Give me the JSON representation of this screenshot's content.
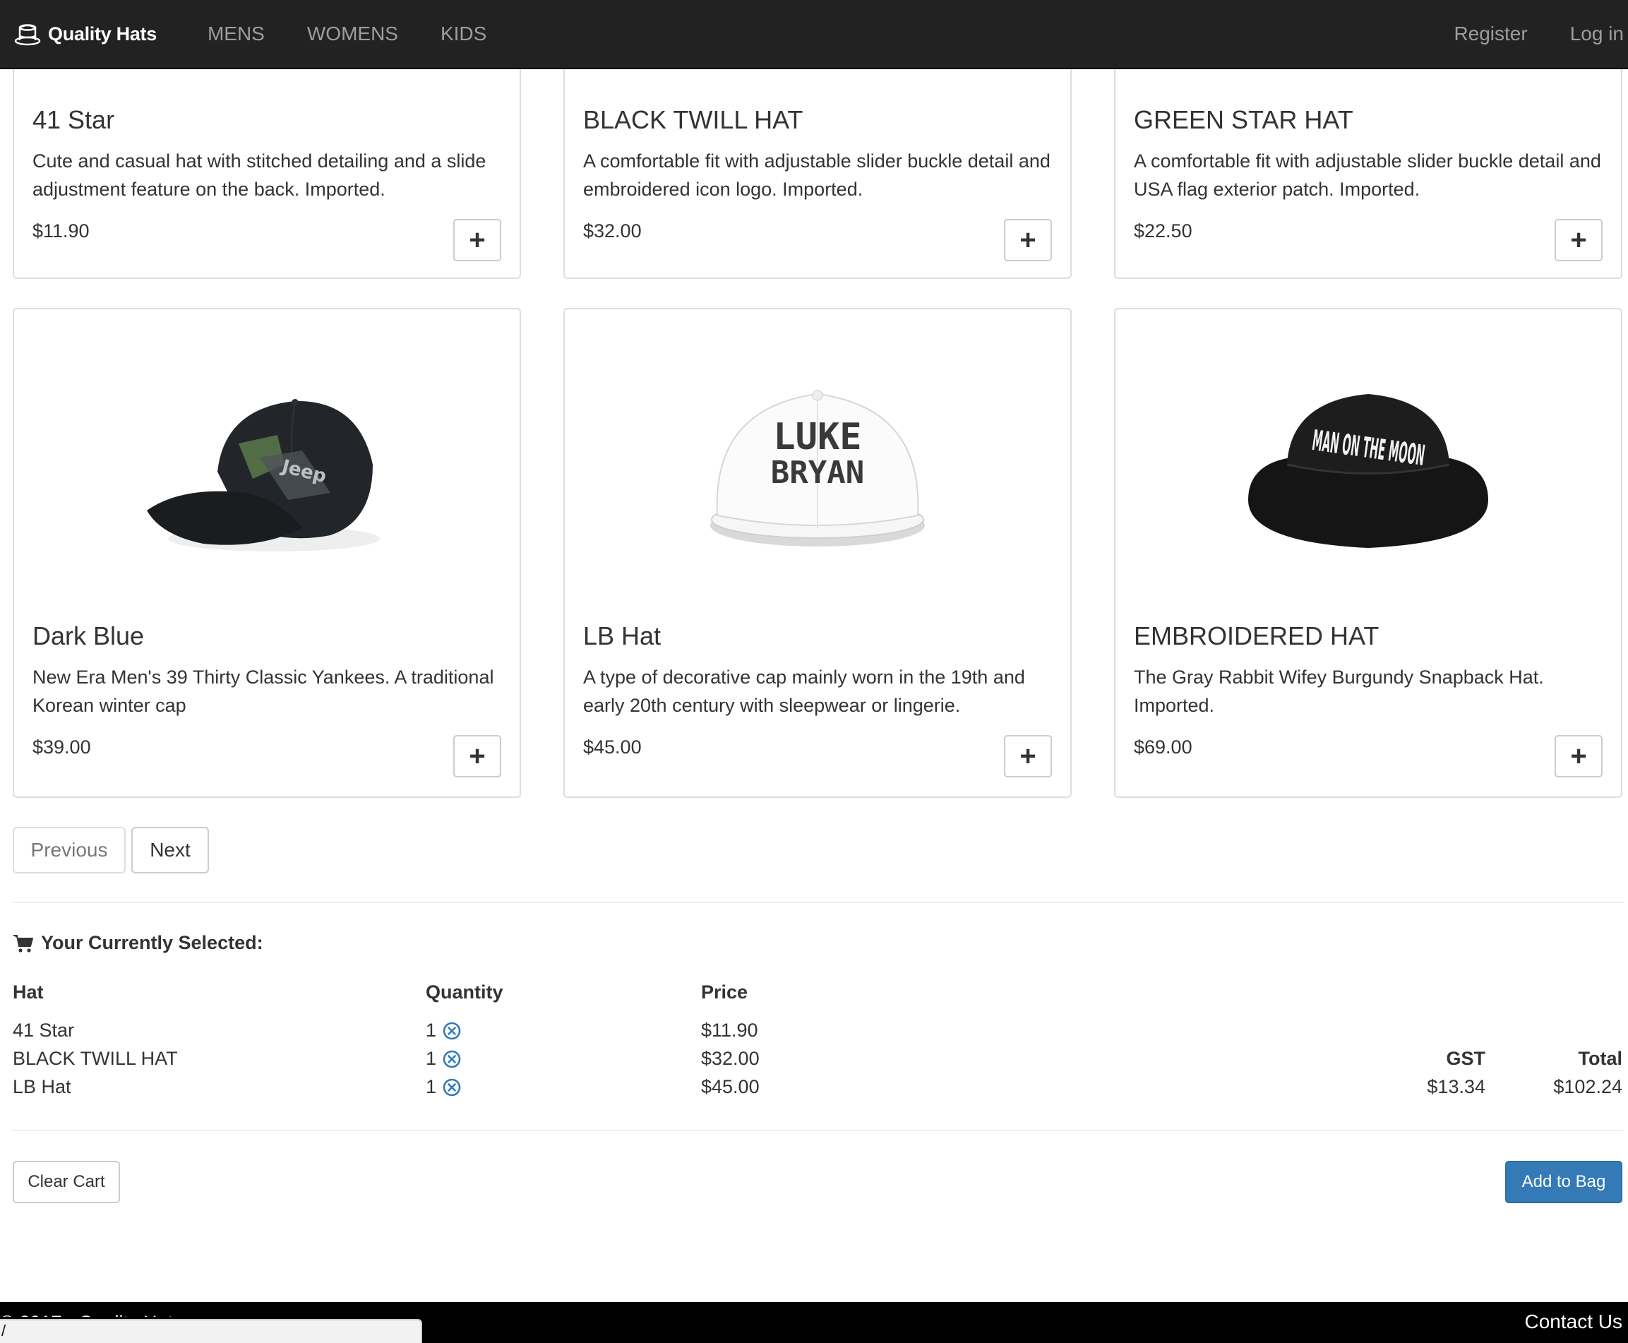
{
  "navbar": {
    "brand": "Quality Hats",
    "links": [
      "MENS",
      "WOMENS",
      "KIDS"
    ],
    "register": "Register",
    "login": "Log in"
  },
  "products_top": [
    {
      "title": "41 Star",
      "description": "Cute and casual hat with stitched detailing and a slide adjustment feature on the back. Imported.",
      "price": "$11.90"
    },
    {
      "title": "BLACK TWILL HAT",
      "description": "A comfortable fit with adjustable slider buckle detail and embroidered icon logo. Imported.",
      "price": "$32.00"
    },
    {
      "title": "GREEN STAR HAT",
      "description": "A comfortable fit with adjustable slider buckle detail and USA flag exterior patch. Imported.",
      "price": "$22.50"
    }
  ],
  "products_bottom": [
    {
      "title": "Dark Blue",
      "description": "New Era Men's 39 Thirty Classic Yankees. A traditional Korean winter cap",
      "price": "$39.00",
      "image": "black-baseball-cap-image",
      "image_text": [
        "Jeep"
      ]
    },
    {
      "title": "LB Hat",
      "description": "A type of decorative cap mainly worn in the 19th and early 20th century with sleepwear or lingerie.",
      "price": "$45.00",
      "image": "white-snapback-image",
      "image_text": [
        "LUKE",
        "BRYAN"
      ]
    },
    {
      "title": "EMBROIDERED HAT",
      "description": "The Gray Rabbit Wifey Burgundy Snapback Hat. Imported.",
      "price": "$69.00",
      "image": "black-bucket-hat-image",
      "image_text": [
        "MAN ON THE MOON"
      ]
    }
  ],
  "add_button_symbol": "+",
  "pagination": {
    "previous": "Previous",
    "next": "Next"
  },
  "cart": {
    "heading": "Your Currently Selected:",
    "columns": {
      "hat": "Hat",
      "quantity": "Quantity",
      "price": "Price"
    },
    "items": [
      {
        "hat": "41 Star",
        "quantity": "1",
        "price": "$11.90"
      },
      {
        "hat": "BLACK TWILL HAT",
        "quantity": "1",
        "price": "$32.00"
      },
      {
        "hat": "LB Hat",
        "quantity": "1",
        "price": "$45.00"
      }
    ],
    "gst_label": "GST",
    "gst_value": "$13.34",
    "total_label": "Total",
    "total_value": "$102.24",
    "clear_label": "Clear Cart",
    "add_label": "Add to Bag"
  },
  "footer": {
    "copyright": "© 2017 - Quality Hats",
    "contact": "Contact Us"
  },
  "status_bar_text": "/",
  "colors": {
    "navbar": "#222222",
    "primary": "#337ab7",
    "remove_icon": "#337ab7",
    "footer": "#000000"
  }
}
